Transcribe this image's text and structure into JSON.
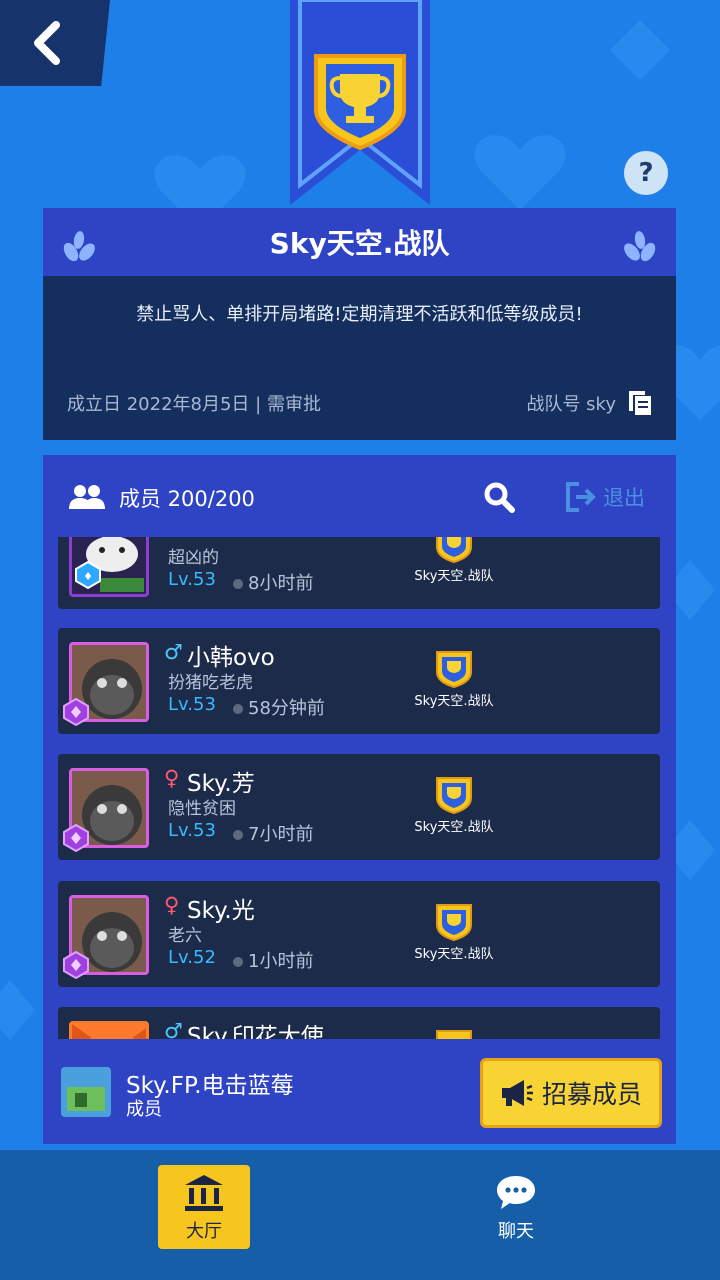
{
  "app": {
    "team_title": "Sky天空.战队",
    "description": "禁止骂人、单排开局堵路!定期清理不活跃和低等级成员!",
    "founded": "成立日 2022年8月5日 | 需审批",
    "team_id": "战队号 sky"
  },
  "members_header": {
    "label": "成员 200/200",
    "exit_label": "退出"
  },
  "members": [
    {
      "gender": "",
      "name": "",
      "signature": "超凶的",
      "level": "Lv.53",
      "last_seen": "8小时前",
      "team": "Sky天空.战队"
    },
    {
      "gender": "♂",
      "name": "小韩ovo",
      "signature": "扮猪吃老虎",
      "level": "Lv.53",
      "last_seen": "58分钟前",
      "team": "Sky天空.战队"
    },
    {
      "gender": "♀",
      "name": "Sky.芳",
      "signature": "隐性贫困",
      "level": "Lv.53",
      "last_seen": "7小时前",
      "team": "Sky天空.战队"
    },
    {
      "gender": "♀",
      "name": "Sky.光",
      "signature": "老六",
      "level": "Lv.52",
      "last_seen": "1小时前",
      "team": "Sky天空.战队"
    },
    {
      "gender": "♂",
      "name": "Sky.印花大使",
      "signature": "",
      "level": "",
      "last_seen": "",
      "team": ""
    }
  ],
  "self": {
    "name": "Sky.FP.电击蓝莓",
    "role": "成员",
    "recruit_label": "招募成员"
  },
  "nav": {
    "hall": "大厅",
    "chat": "聊天"
  },
  "colors": {
    "background": "#1e7fe8",
    "panel": "#2f43c5",
    "dark_panel": "#142e5e",
    "accent_yellow": "#f7d334"
  }
}
